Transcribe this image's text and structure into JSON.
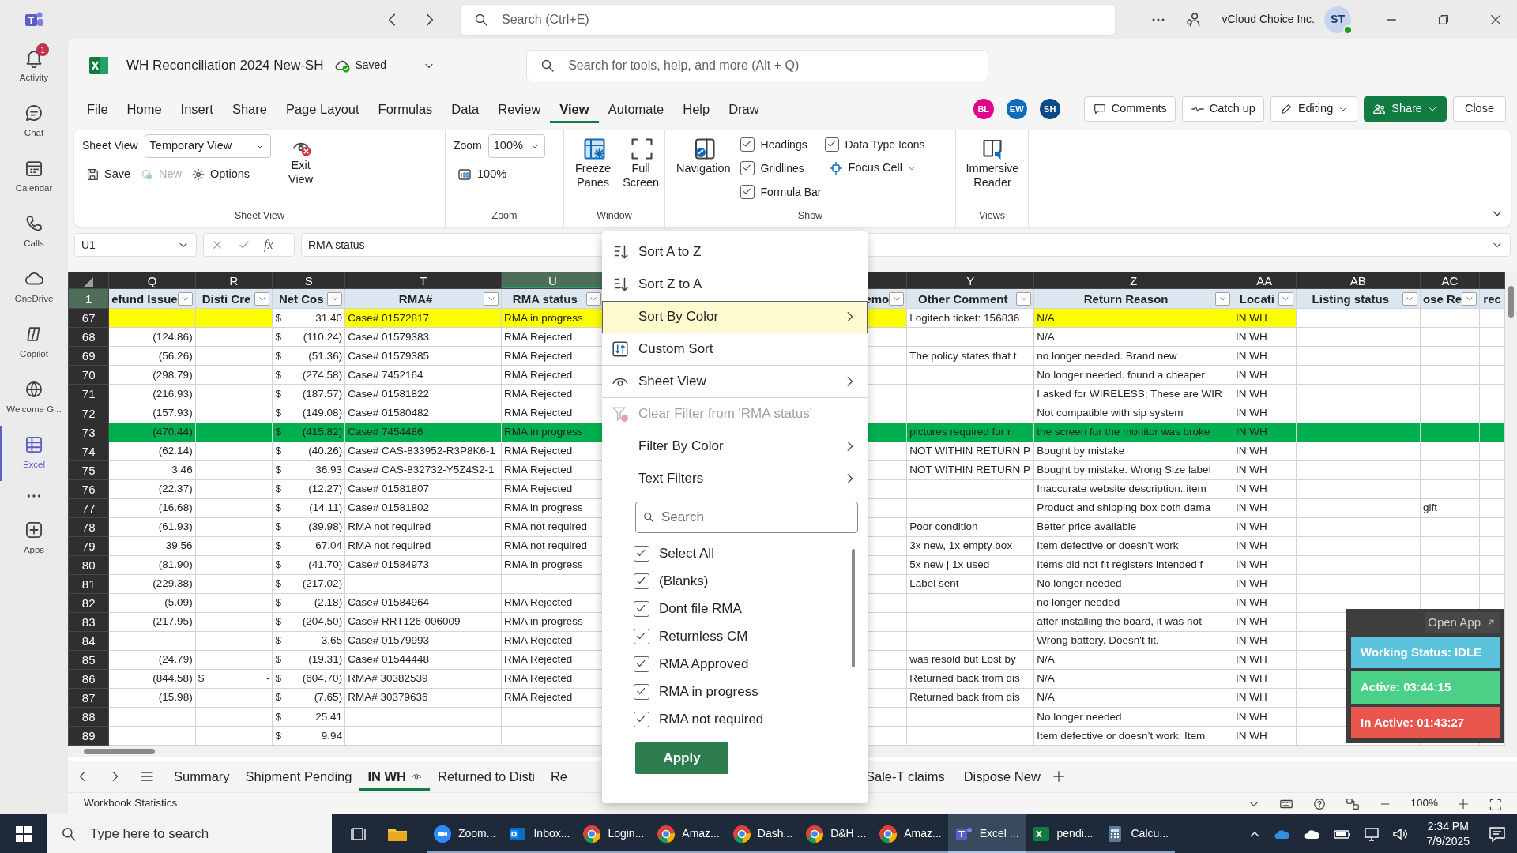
{
  "top_bar": {
    "search_placeholder": "Search (Ctrl+E)",
    "org": "vCloud Choice Inc.",
    "avatar": "ST"
  },
  "rail": [
    {
      "label": "Activity",
      "badge": "1",
      "selected": false
    },
    {
      "label": "Chat",
      "selected": false
    },
    {
      "label": "Calendar",
      "selected": false
    },
    {
      "label": "Calls",
      "selected": false
    },
    {
      "label": "OneDrive",
      "selected": false
    },
    {
      "label": "Copilot",
      "selected": false
    },
    {
      "label": "Welcome G...",
      "selected": false
    },
    {
      "label": "Excel",
      "selected": true
    },
    {
      "label": "Apps",
      "selected": false
    }
  ],
  "workbook": {
    "title": "WH Reconciliation 2024 New-SH",
    "save_status": "Saved",
    "search_placeholder": "Search for tools, help, and more (Alt + Q)"
  },
  "menu_tabs": [
    {
      "label": "File",
      "selected": false
    },
    {
      "label": "Home",
      "selected": false
    },
    {
      "label": "Insert",
      "selected": false
    },
    {
      "label": "Share",
      "selected": false
    },
    {
      "label": "Page Layout",
      "selected": false
    },
    {
      "label": "Formulas",
      "selected": false
    },
    {
      "label": "Data",
      "selected": false
    },
    {
      "label": "Review",
      "selected": false
    },
    {
      "label": "View",
      "selected": true
    },
    {
      "label": "Automate",
      "selected": false
    },
    {
      "label": "Help",
      "selected": false
    },
    {
      "label": "Draw",
      "selected": false
    }
  ],
  "collaborators": [
    {
      "initials": "BL",
      "color": "#e3008c"
    },
    {
      "initials": "EW",
      "color": "#0f6cbd"
    },
    {
      "initials": "SH",
      "color": "#0c4a86"
    }
  ],
  "actions": [
    {
      "label": "Comments",
      "kind": "outline",
      "dropdown": false
    },
    {
      "label": "Catch up",
      "kind": "outline",
      "dropdown": false
    },
    {
      "label": "Editing",
      "kind": "outline",
      "dropdown": true
    },
    {
      "label": "Share",
      "kind": "primary",
      "dropdown": true
    },
    {
      "label": "Close",
      "kind": "outline",
      "dropdown": false
    }
  ],
  "ribbon": {
    "sheet_view": {
      "label": "Sheet View",
      "view": "Temporary View",
      "save": "Save",
      "new": {
        "label": "New",
        "disabled": true
      },
      "options": "Options",
      "exit": "Exit View",
      "group": "Sheet View"
    },
    "zoom": {
      "label": "Zoom",
      "value": "100%",
      "reset": "100%",
      "group": "Zoom"
    },
    "window": {
      "freeze": "Freeze Panes",
      "full": "Full Screen",
      "group": "Window"
    },
    "show": {
      "navigation": "Navigation",
      "checks": [
        {
          "label": "Headings",
          "checked": true
        },
        {
          "label": "Gridlines",
          "checked": true
        },
        {
          "label": "Formula Bar",
          "checked": true
        },
        {
          "label": "Data Type Icons",
          "checked": true
        }
      ],
      "focus_cell": "Focus Cell",
      "group": "Show"
    },
    "views": {
      "immersive": "Immersive Reader",
      "group": "Views"
    }
  },
  "formula_bar": {
    "name_box": "U1",
    "function_symbol": "fx",
    "formula": "RMA status"
  },
  "grid": {
    "columns": [
      {
        "letter": "Q",
        "header": "efund Issue",
        "filter": true,
        "selected": false
      },
      {
        "letter": "R",
        "header": "Disti Cre",
        "filter": true,
        "selected": false
      },
      {
        "letter": "S",
        "header": "Net Cos",
        "filter": true,
        "selected": false
      },
      {
        "letter": "T",
        "header": "RMA#",
        "filter": true,
        "selected": false
      },
      {
        "letter": "U",
        "header": "RMA status",
        "filter": true,
        "selected": true
      },
      {
        "header": "emo",
        "filter": true,
        "selected": false
      },
      {
        "letter": "Y",
        "header": "Other Comment",
        "filter": true,
        "selected": false
      },
      {
        "letter": "Z",
        "header": "Return Reason",
        "filter": true,
        "selected": false
      },
      {
        "letter": "AA",
        "header": "Locati",
        "filter": true,
        "selected": false
      },
      {
        "letter": "AB",
        "header": "Listing status",
        "filter": true,
        "selected": false
      },
      {
        "letter": "AC",
        "header": "ose Re",
        "filter": true,
        "selected": false
      },
      {
        "header": "rec",
        "filter": false,
        "selected": false
      }
    ],
    "header_row": "1",
    "rows": [
      {
        "number": "67",
        "color": "#ffff00",
        "fill": [
          true,
          true,
          false,
          true,
          true,
          true,
          false,
          true,
          true,
          false,
          false,
          false
        ],
        "cells": {
          "S": [
            "$",
            "31.40"
          ],
          "T": "Case# 01572817",
          "U": "RMA in progress",
          "Y": "Logitech ticket: 156836",
          "Z": "N/A",
          "AA": "IN WH"
        }
      },
      {
        "number": "68",
        "cells": {
          "Q": "(124.86)",
          "S": [
            "$",
            "(110.24)"
          ],
          "T": "Case# 01579383",
          "U": "RMA Rejected",
          "Z": "N/A",
          "AA": "IN WH"
        }
      },
      {
        "number": "69",
        "cells": {
          "Q": "(56.26)",
          "S": [
            "$",
            "(51.36)"
          ],
          "T": "Case# 01579385",
          "U": "RMA Rejected",
          "Y": "The policy states that t",
          "Z": "no longer needed. Brand new",
          "AA": "IN WH"
        }
      },
      {
        "number": "70",
        "cells": {
          "Q": "(298.79)",
          "S": [
            "$",
            "(274.58)"
          ],
          "T": "Case# 7452164",
          "U": "RMA Rejected",
          "Z": "No longer needed. found a cheaper",
          "AA": "IN WH"
        }
      },
      {
        "number": "71",
        "cells": {
          "Q": "(216.93)",
          "S": [
            "$",
            "(187.57)"
          ],
          "T": "Case# 01581822",
          "U": "RMA Rejected",
          "Z": "I asked for WIRELESS; These are WIR",
          "AA": "IN WH"
        }
      },
      {
        "number": "72",
        "cells": {
          "Q": "(157.93)",
          "S": [
            "$",
            "(149.08)"
          ],
          "T": "Case# 01580482",
          "U": "RMA Rejected",
          "Z": "Not compatible with sip system",
          "AA": "IN WH"
        }
      },
      {
        "number": "73",
        "color": "#00b050",
        "fill": [
          true,
          true,
          true,
          true,
          true,
          true,
          true,
          true,
          true,
          true,
          true,
          true
        ],
        "cells": {
          "Q": "(470.44)",
          "S": [
            "$",
            "(415.82)"
          ],
          "T": "Case# 7454486",
          "U": "RMA in progress",
          "Y": "pictures required for r",
          "Z": "the screen for the monitor was broke",
          "AA": "IN WH"
        }
      },
      {
        "number": "74",
        "cells": {
          "Q": "(62.14)",
          "S": [
            "$",
            "(40.26)"
          ],
          "T": "Case# CAS-833952-R3P8K6-1",
          "U": "RMA Rejected",
          "Y": "NOT WITHIN RETURN P",
          "Z": "Bought by mistake",
          "AA": "IN WH"
        }
      },
      {
        "number": "75",
        "cells": {
          "Q": "3.46",
          "S": [
            "$",
            "36.93"
          ],
          "T": "Case# CAS-832732-Y5Z4S2-1",
          "U": "RMA Rejected",
          "Y": "NOT WITHIN RETURN P",
          "Z": "Bought by mistake. Wrong Size label",
          "AA": "IN WH"
        }
      },
      {
        "number": "76",
        "cells": {
          "Q": "(22.37)",
          "S": [
            "$",
            "(12.27)"
          ],
          "T": "Case# 01581807",
          "U": "RMA Rejected",
          "Z": "Inaccurate website description. item",
          "AA": "IN WH"
        }
      },
      {
        "number": "77",
        "cells": {
          "Q": "(16.68)",
          "S": [
            "$",
            "(14.11)"
          ],
          "T": "Case# 01581802",
          "U": "RMA in progress",
          "Z": "Product and shipping box both dama",
          "AA": "IN WH",
          "AC": "gift"
        }
      },
      {
        "number": "78",
        "cells": {
          "Q": "(61.93)",
          "S": [
            "$",
            "(39.98)"
          ],
          "T": "RMA not required",
          "U": "RMA not required",
          "Y": "Poor condition",
          "Z": "Better price available",
          "AA": "IN WH"
        }
      },
      {
        "number": "79",
        "cells": {
          "Q": "39.56",
          "S": [
            "$",
            "67.04"
          ],
          "T": "RMA not required",
          "U": "RMA not required",
          "Y": "3x new, 1x empty box",
          "Z": "Item defective or doesn’t work",
          "AA": "IN WH"
        }
      },
      {
        "number": "80",
        "cells": {
          "Q": "(81.90)",
          "S": [
            "$",
            "(41.70)"
          ],
          "T": "Case# 01584973",
          "U": "RMA in progress",
          "Y": "5x new | 1x used",
          "Z": "Items did not fit registers intended f",
          "AA": "IN WH"
        }
      },
      {
        "number": "81",
        "cells": {
          "Q": "(229.38)",
          "S": [
            "$",
            "(217.02)"
          ],
          "Y": "Label sent",
          "Z": "No longer needed",
          "AA": "IN WH"
        }
      },
      {
        "number": "82",
        "cells": {
          "Q": "(5.09)",
          "S": [
            "$",
            "(2.18)"
          ],
          "T": "Case# 01584964",
          "U": "RMA Rejected",
          "Z": "no longer needed",
          "AA": "IN WH"
        }
      },
      {
        "number": "83",
        "cells": {
          "Q": "(217.95)",
          "S": [
            "$",
            "(204.50)"
          ],
          "T": "Case# RRT126-006009",
          "U": "RMA in progress",
          "Z": "after installing the board, it was not",
          "AA": "IN WH"
        }
      },
      {
        "number": "84",
        "cells": {
          "S": [
            "$",
            "3.65"
          ],
          "T": "Case# 01579993",
          "U": "RMA Rejected",
          "Z": "Wrong battery.  Doesn't fit.",
          "AA": "IN WH"
        }
      },
      {
        "number": "85",
        "cells": {
          "Q": "(24.79)",
          "S": [
            "$",
            "(19.31)"
          ],
          "T": "Case# 01544448",
          "U": "RMA Rejected",
          "Y": "was resold but Lost by",
          "Z": "N/A",
          "AA": "IN WH"
        }
      },
      {
        "number": "86",
        "cells": {
          "Q": "(844.58)",
          "R": [
            "$",
            "-"
          ],
          "S": [
            "$",
            "(604.70)"
          ],
          "T": "RMA# 30382539",
          "U": "RMA Rejected",
          "Y": "Returned back from dis",
          "Z": "N/A",
          "AA": "IN WH"
        }
      },
      {
        "number": "87",
        "cells": {
          "Q": "(15.98)",
          "S": [
            "$",
            "(7.65)"
          ],
          "T": "RMA# 30379636",
          "U": "RMA Rejected",
          "Y": "Returned back from dis",
          "Z": "N/A",
          "AA": "IN WH"
        }
      },
      {
        "number": "88",
        "cells": {
          "S": [
            "$",
            "25.41"
          ],
          "Z": "No longer needed",
          "AA": "IN WH"
        }
      },
      {
        "number": "89",
        "cells": {
          "S": [
            "$",
            "9.94"
          ],
          "Z": "Item defective or doesn’t work. Item",
          "AA": "IN WH"
        }
      }
    ]
  },
  "filter_menu": {
    "items": [
      {
        "label": "Sort A to Z",
        "kind": "sort_up",
        "submenu": false,
        "disabled": false,
        "highlighted": false,
        "group_end": false
      },
      {
        "label": "Sort Z to A",
        "kind": "sort_down",
        "submenu": false,
        "disabled": false,
        "highlighted": false,
        "group_end": false
      },
      {
        "label": "Sort By Color",
        "kind": "plain",
        "submenu": true,
        "disabled": false,
        "highlighted": true,
        "group_end": false
      },
      {
        "label": "Custom Sort",
        "kind": "custom",
        "submenu": false,
        "disabled": false,
        "highlighted": false,
        "group_end": true
      },
      {
        "label": "Sheet View",
        "kind": "eye",
        "submenu": true,
        "disabled": false,
        "highlighted": false,
        "group_end": true
      },
      {
        "label": "Clear Filter from 'RMA status'",
        "kind": "clear",
        "submenu": false,
        "disabled": true,
        "highlighted": false,
        "group_end": false
      },
      {
        "label": "Filter By Color",
        "kind": "plain",
        "submenu": true,
        "disabled": false,
        "highlighted": false,
        "group_end": false
      },
      {
        "label": "Text Filters",
        "kind": "plain",
        "submenu": true,
        "disabled": false,
        "highlighted": false,
        "group_end": false
      }
    ],
    "search_placeholder": "Search",
    "options": [
      {
        "label": "Select All",
        "checked": true
      },
      {
        "label": "(Blanks)",
        "checked": true
      },
      {
        "label": "Dont file RMA",
        "checked": true
      },
      {
        "label": "Returnless CM",
        "checked": true
      },
      {
        "label": "RMA Approved",
        "checked": true
      },
      {
        "label": "RMA in progress",
        "checked": true
      },
      {
        "label": "RMA not required",
        "checked": true
      }
    ],
    "apply": "Apply"
  },
  "status_widget": {
    "open_app": "Open App",
    "lines": [
      {
        "text": "Working Status: IDLE",
        "color": "#5cc3dc"
      },
      {
        "text": "Active: 03:44:15",
        "color": "#4ccf86"
      },
      {
        "text": "In Active: 01:43:27",
        "color": "#e8564d"
      }
    ]
  },
  "sheet_tabs": [
    {
      "label": "Summary",
      "selected": false
    },
    {
      "label": "Shipment Pending",
      "selected": false
    },
    {
      "label": "IN WH",
      "selected": true
    },
    {
      "label": "Returned to Disti",
      "selected": false
    },
    {
      "label": "Re",
      "selected": false
    },
    {
      "label": "Sale-T claims",
      "selected": false
    },
    {
      "label": "Dispose New",
      "selected": false
    }
  ],
  "status_bar": {
    "left": "Workbook Statistics",
    "zoom": "100%"
  },
  "taskbar": {
    "search_placeholder": "Type here to search",
    "apps": [
      {
        "label": "Zoom...",
        "selected": false
      },
      {
        "label": "Inbox...",
        "selected": false
      },
      {
        "label": "Login...",
        "selected": false
      },
      {
        "label": "Amaz...",
        "selected": false
      },
      {
        "label": "Dash...",
        "selected": false
      },
      {
        "label": "D&H ...",
        "selected": false
      },
      {
        "label": "Amaz...",
        "selected": false
      },
      {
        "label": "Excel ...",
        "selected": true
      },
      {
        "label": "pendi...",
        "selected": false
      },
      {
        "label": "Calcu...",
        "selected": false
      }
    ],
    "time": "2:34 PM",
    "date": "7/9/2025"
  }
}
